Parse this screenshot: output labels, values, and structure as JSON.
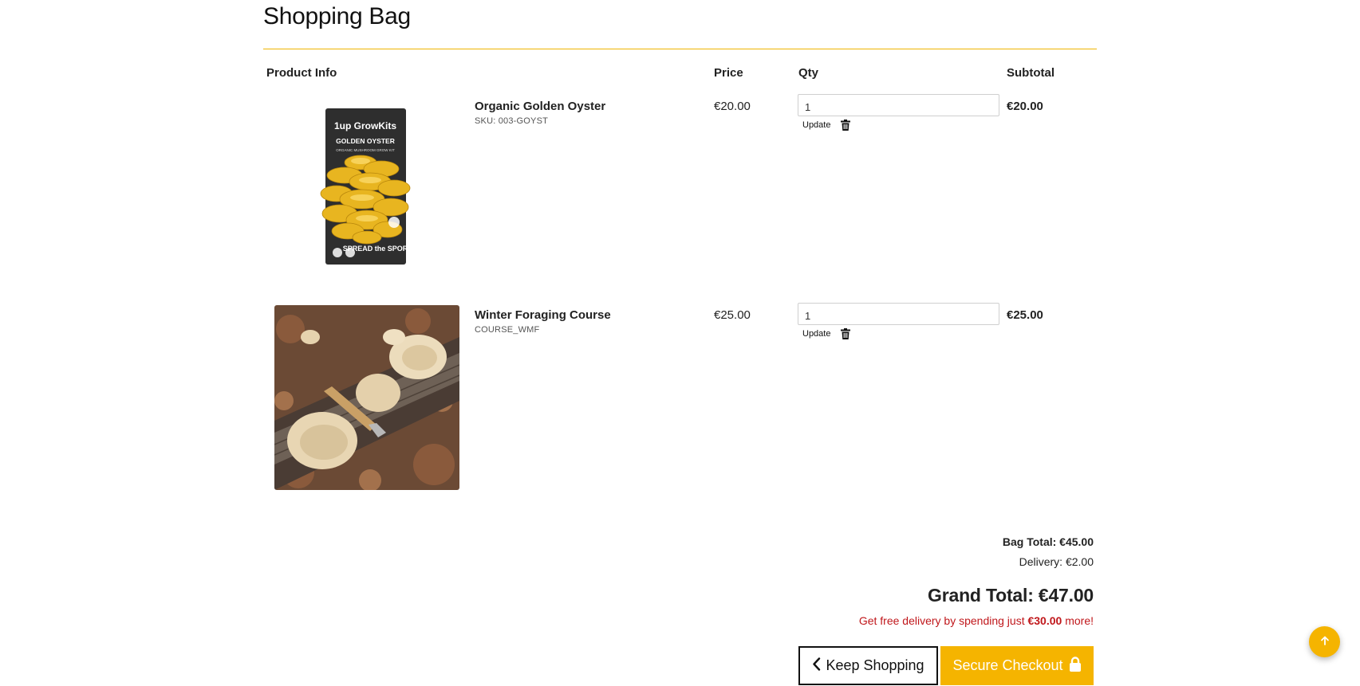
{
  "page": {
    "title": "Shopping Bag"
  },
  "columns": {
    "product": "Product Info",
    "price": "Price",
    "qty": "Qty",
    "subtotal": "Subtotal"
  },
  "items": [
    {
      "name": "Organic Golden Oyster",
      "sku": "SKU: 003-GOYST",
      "price": "€20.00",
      "qty": "1",
      "update_label": "Update",
      "subtotal": "€20.00",
      "image_icon": "golden-oyster-grow-kit-image",
      "image_text": [
        "1up GrowKits",
        "GOLDEN OYSTER",
        "ORGANIC MUSHROOM GROW KIT",
        "SPREAD the SPORE!"
      ]
    },
    {
      "name": "Winter Foraging Course",
      "sku": "COURSE_WMF",
      "price": "€25.00",
      "qty": "1",
      "update_label": "Update",
      "subtotal": "€25.00",
      "image_icon": "foraged-mushrooms-photo"
    }
  ],
  "totals": {
    "bag_total": "Bag Total: €45.00",
    "delivery": "Delivery: €2.00",
    "grand_total": "Grand Total: €47.00",
    "free_delivery_prefix": "Get free delivery by spending just ",
    "free_delivery_amount": "€30.00",
    "free_delivery_suffix": " more!"
  },
  "actions": {
    "keep_shopping": "Keep Shopping",
    "secure_checkout": "Secure Checkout"
  },
  "colors": {
    "accent": "#f5b400",
    "rule": "#f0b400",
    "alert": "#c0171b",
    "text": "#222222"
  },
  "icons": {
    "back": "chevron-left-icon",
    "checkout": "lock-icon",
    "remove": "trash-icon",
    "scroll_top": "arrow-up-icon"
  }
}
